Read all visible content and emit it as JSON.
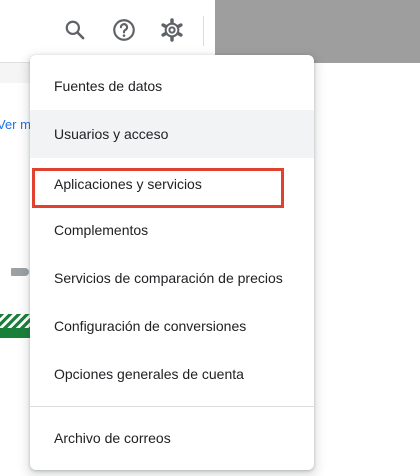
{
  "toolbar": {
    "icons": [
      "search-icon",
      "help-icon",
      "gear-icon"
    ]
  },
  "background": {
    "link_text": "Ver m"
  },
  "menu": {
    "items": [
      {
        "label": "Fuentes de datos"
      },
      {
        "label": "Usuarios y acceso"
      },
      {
        "label": "Aplicaciones y servicios"
      },
      {
        "label": "Complementos"
      },
      {
        "label": "Servicios de comparación de precios"
      },
      {
        "label": "Configuración de conversiones"
      },
      {
        "label": "Opciones generales de cuenta"
      },
      {
        "label": "Archivo de correos"
      }
    ],
    "hovered_item": "Usuarios y acceso",
    "highlighted_item": "Aplicaciones y servicios"
  },
  "colors": {
    "highlight": "#e0422f",
    "link": "#1a73e8",
    "green": "#188038",
    "hover_background": "#f1f3f4",
    "text": "#202124",
    "icon": "#5f6368"
  }
}
